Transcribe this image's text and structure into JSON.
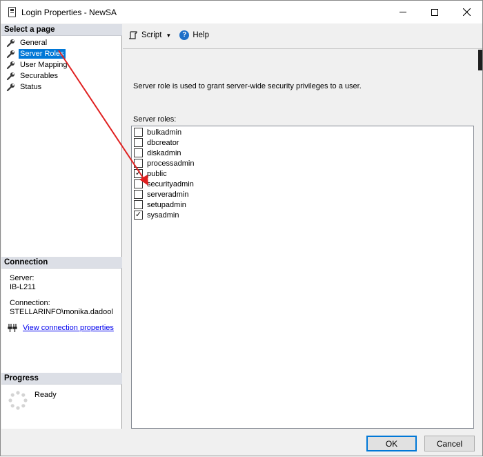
{
  "window": {
    "title": "Login Properties - NewSA"
  },
  "left_pane": {
    "select_page_header": "Select a page",
    "pages": [
      {
        "label": "General",
        "icon": "wrench-icon",
        "selected": false
      },
      {
        "label": "Server Roles",
        "icon": "wrench-icon",
        "selected": true
      },
      {
        "label": "User Mapping",
        "icon": "wrench-icon",
        "selected": false
      },
      {
        "label": "Securables",
        "icon": "wrench-icon",
        "selected": false
      },
      {
        "label": "Status",
        "icon": "wrench-icon",
        "selected": false
      }
    ],
    "connection_header": "Connection",
    "server_label": "Server:",
    "server_value": "IB-L211",
    "connection_label": "Connection:",
    "connection_value": "STELLARINFO\\monika.dadool",
    "view_connection_link": "View connection properties",
    "progress_header": "Progress",
    "progress_status": "Ready"
  },
  "toolbar": {
    "script_label": "Script",
    "help_label": "Help"
  },
  "main": {
    "description": "Server role is used to grant server-wide security privileges to a user.",
    "roles_label": "Server roles:",
    "roles": [
      {
        "name": "bulkadmin",
        "checked": false
      },
      {
        "name": "dbcreator",
        "checked": false
      },
      {
        "name": "diskadmin",
        "checked": false
      },
      {
        "name": "processadmin",
        "checked": false
      },
      {
        "name": "public",
        "checked": true
      },
      {
        "name": "securityadmin",
        "checked": false
      },
      {
        "name": "serveradmin",
        "checked": false
      },
      {
        "name": "setupadmin",
        "checked": false
      },
      {
        "name": "sysadmin",
        "checked": true
      }
    ]
  },
  "buttons": {
    "ok_label": "OK",
    "cancel_label": "Cancel"
  },
  "colors": {
    "selection": "#0078d7",
    "annotation_arrow": "#e02020",
    "link": "#0000ee"
  }
}
